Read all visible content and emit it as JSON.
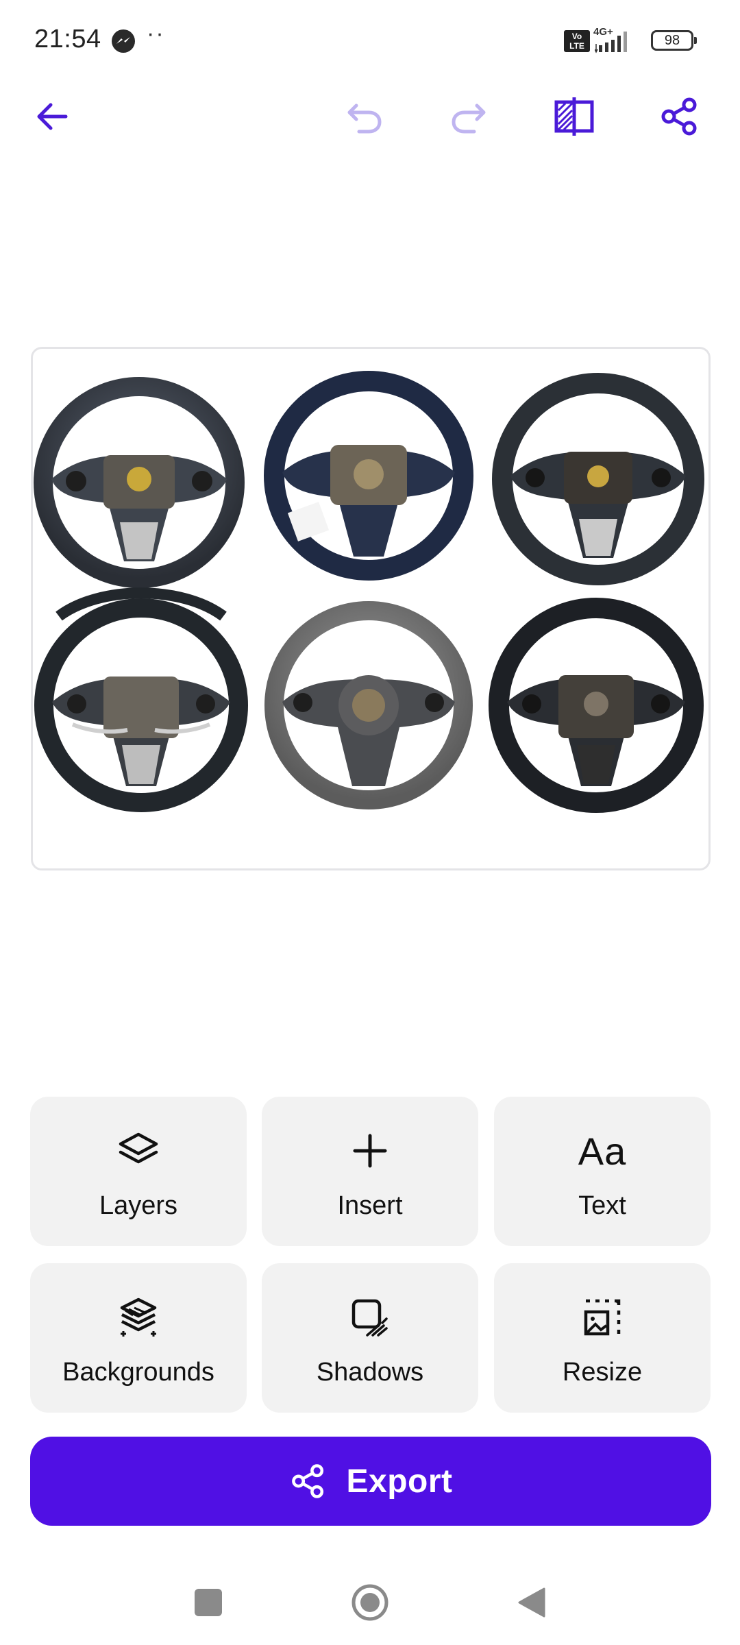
{
  "status_bar": {
    "time": "21:54",
    "dots": "··",
    "volte": "Vo\nLTE",
    "network": "4G+",
    "battery": "98",
    "icons": [
      "messenger-icon",
      "volte-icon",
      "signal-icon",
      "battery-icon"
    ]
  },
  "toolbar": {
    "icons": [
      "back-arrow-icon",
      "undo-icon",
      "redo-icon",
      "compare-icon",
      "share-icon"
    ],
    "accent": "#4a1ad8",
    "disabled": "#bfb4f0"
  },
  "canvas": {
    "description_items": 6,
    "border": "#e4e4e7"
  },
  "tools": [
    {
      "label": "Layers",
      "icon": "layers-icon"
    },
    {
      "label": "Insert",
      "icon": "plus-icon"
    },
    {
      "label": "Text",
      "icon": "text-icon",
      "glyph": "Aa"
    },
    {
      "label": "Backgrounds",
      "icon": "backgrounds-icon"
    },
    {
      "label": "Shadows",
      "icon": "shadow-icon"
    },
    {
      "label": "Resize",
      "icon": "resize-icon"
    }
  ],
  "export": {
    "label": "Export",
    "icon": "share-icon",
    "color": "#5010e4"
  },
  "nav_bar": {
    "icons": [
      "recents-icon",
      "home-icon",
      "back-icon"
    ]
  }
}
